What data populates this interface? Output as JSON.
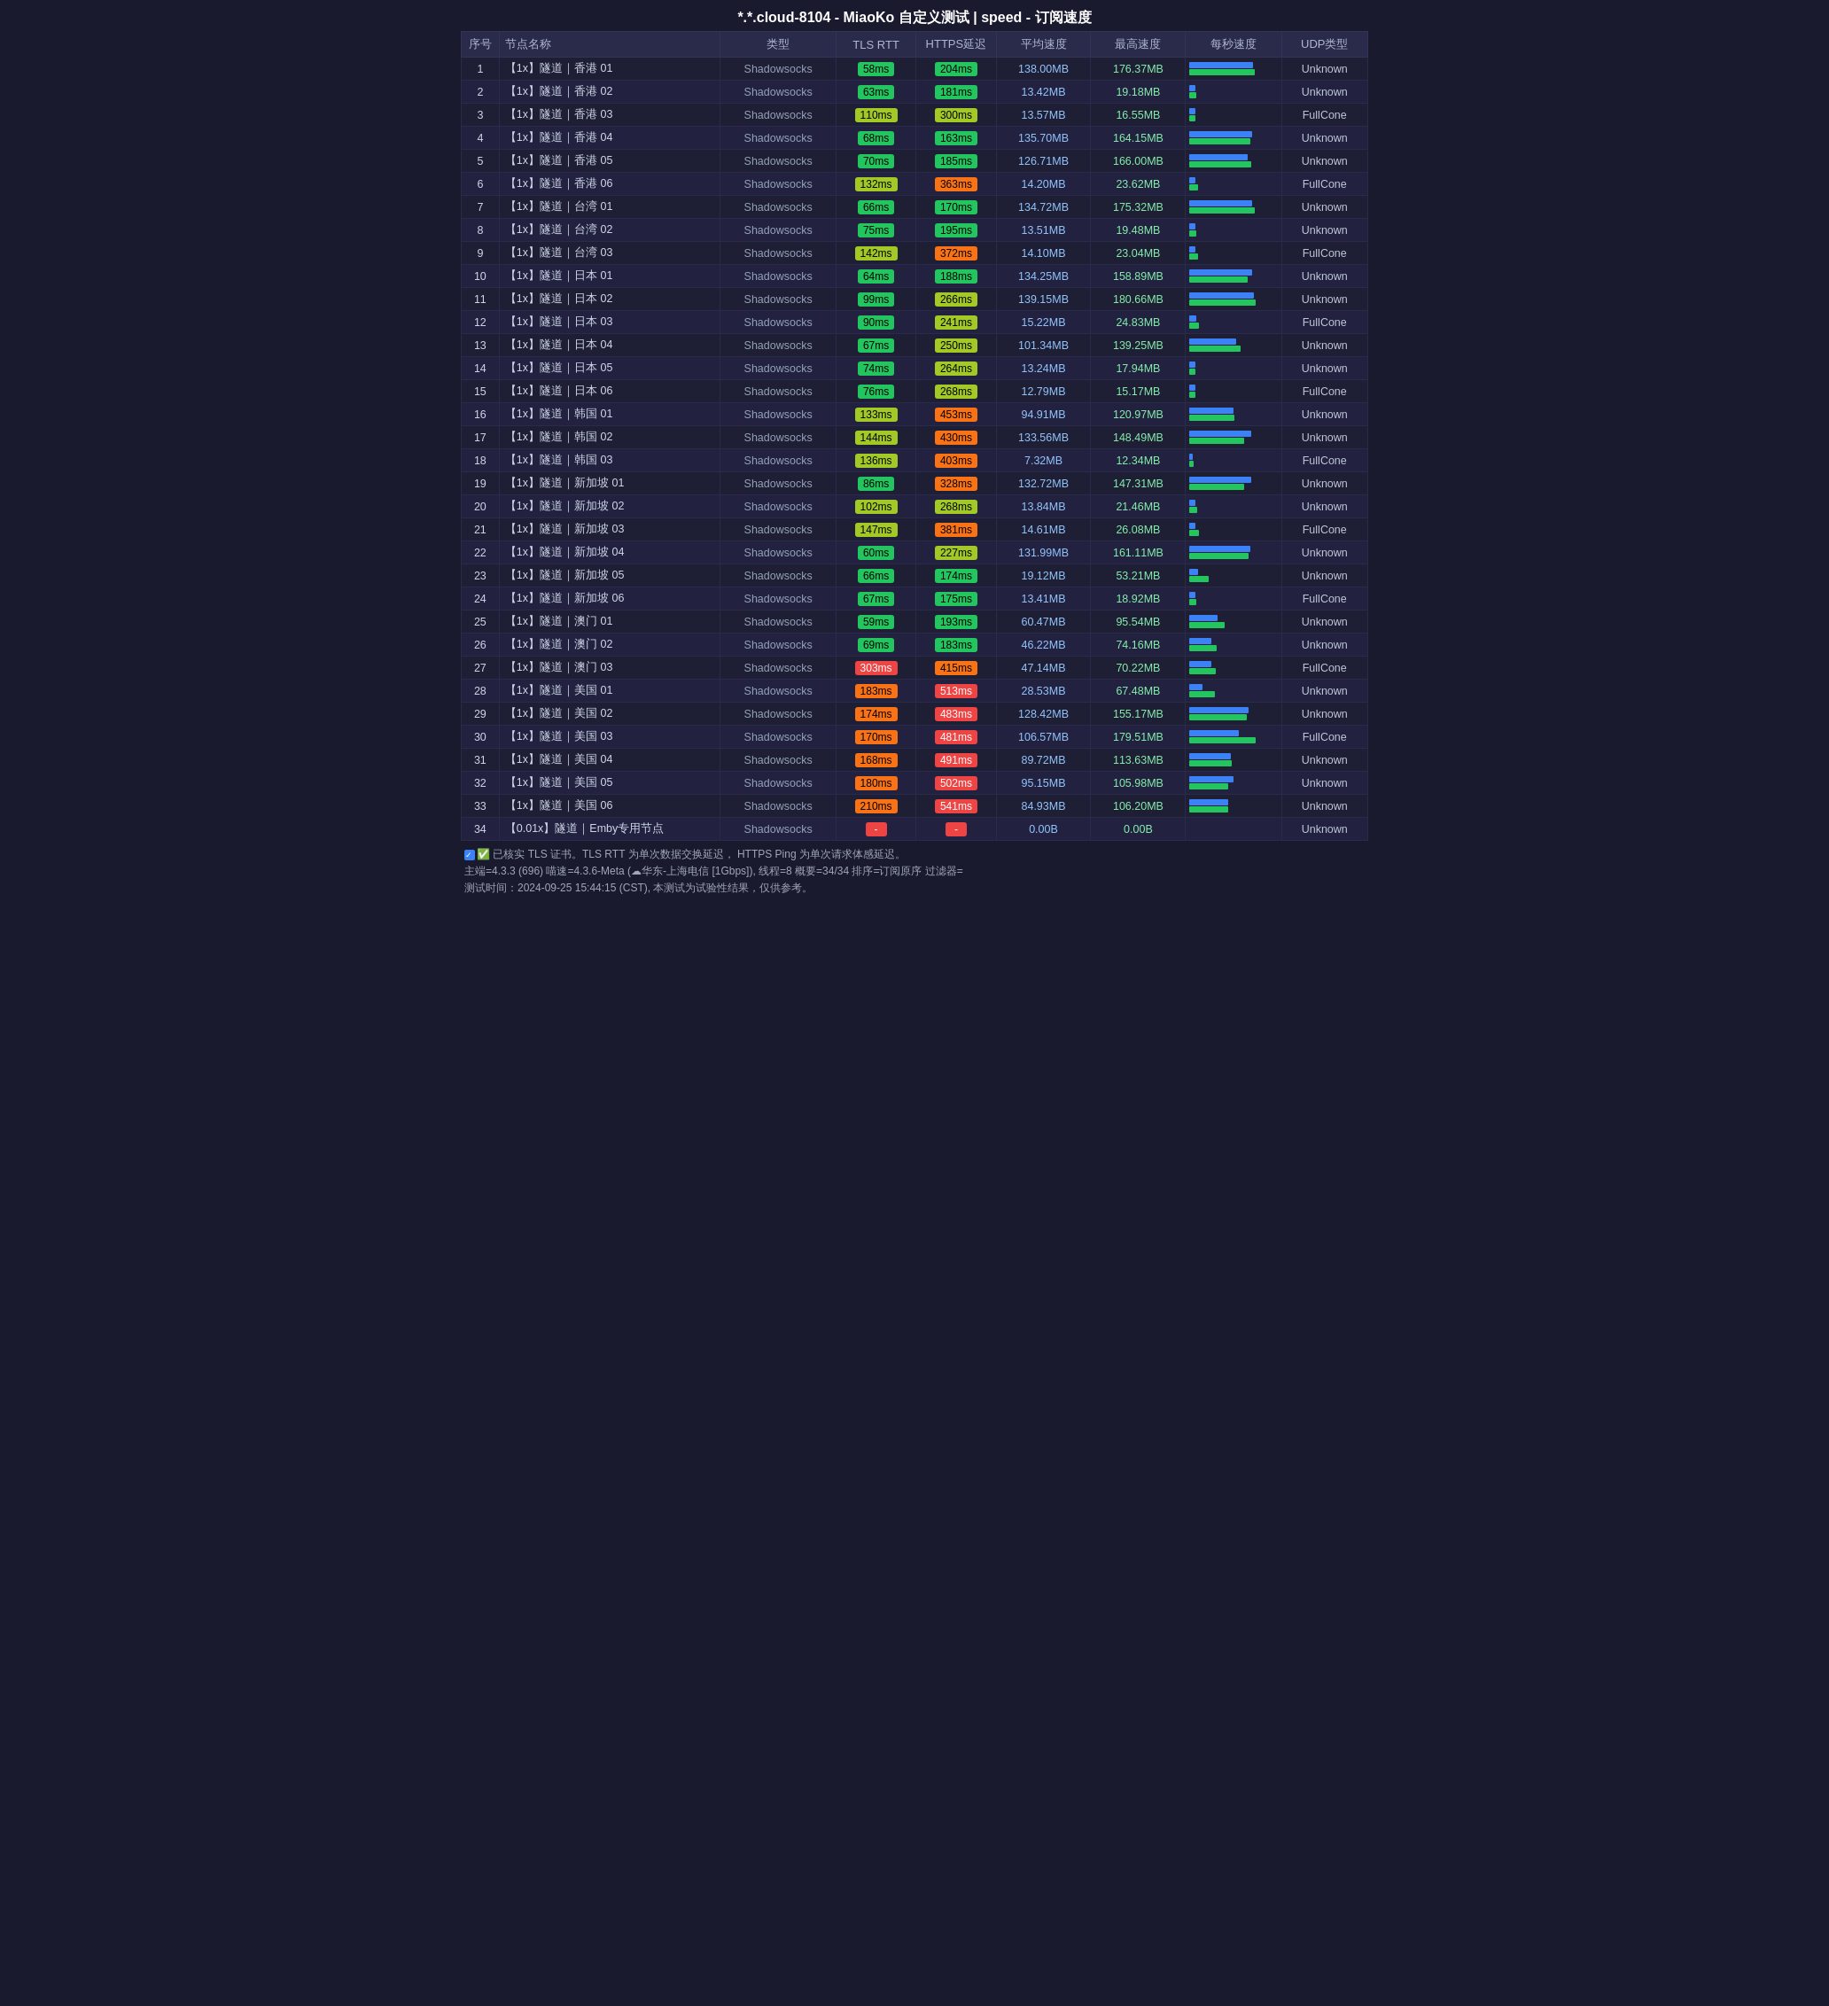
{
  "title": "*.*.cloud-8104 - MiaoKo 自定义测试 | speed - 订阅速度",
  "headers": [
    "序号",
    "节点名称",
    "类型",
    "TLS RTT",
    "HTTPS延迟",
    "平均速度",
    "最高速度",
    "每秒速度",
    "UDP类型"
  ],
  "rows": [
    {
      "id": 1,
      "name": "【1x】隧道｜香港 01",
      "type": "Shadowsocks",
      "tls": "58ms",
      "https": "204ms",
      "avg": "138.00MB",
      "max": "176.37MB",
      "bar_avg": 88,
      "bar_max": 90,
      "udp": "Unknown",
      "tls_color": "green",
      "https_color": "green"
    },
    {
      "id": 2,
      "name": "【1x】隧道｜香港 02",
      "type": "Shadowsocks",
      "tls": "63ms",
      "https": "181ms",
      "avg": "13.42MB",
      "max": "19.18MB",
      "bar_avg": 9,
      "bar_max": 10,
      "udp": "Unknown",
      "tls_color": "green",
      "https_color": "green"
    },
    {
      "id": 3,
      "name": "【1x】隧道｜香港 03",
      "type": "Shadowsocks",
      "tls": "110ms",
      "https": "300ms",
      "avg": "13.57MB",
      "max": "16.55MB",
      "bar_avg": 9,
      "bar_max": 9,
      "udp": "FullCone",
      "tls_color": "yellow",
      "https_color": "yellow"
    },
    {
      "id": 4,
      "name": "【1x】隧道｜香港 04",
      "type": "Shadowsocks",
      "tls": "68ms",
      "https": "163ms",
      "avg": "135.70MB",
      "max": "164.15MB",
      "bar_avg": 86,
      "bar_max": 84,
      "udp": "Unknown",
      "tls_color": "green",
      "https_color": "green"
    },
    {
      "id": 5,
      "name": "【1x】隧道｜香港 05",
      "type": "Shadowsocks",
      "tls": "70ms",
      "https": "185ms",
      "avg": "126.71MB",
      "max": "166.00MB",
      "bar_avg": 80,
      "bar_max": 85,
      "udp": "Unknown",
      "tls_color": "green",
      "https_color": "green"
    },
    {
      "id": 6,
      "name": "【1x】隧道｜香港 06",
      "type": "Shadowsocks",
      "tls": "132ms",
      "https": "363ms",
      "avg": "14.20MB",
      "max": "23.62MB",
      "bar_avg": 9,
      "bar_max": 12,
      "udp": "FullCone",
      "tls_color": "yellow",
      "https_color": "orange"
    },
    {
      "id": 7,
      "name": "【1x】隧道｜台湾 01",
      "type": "Shadowsocks",
      "tls": "66ms",
      "https": "170ms",
      "avg": "134.72MB",
      "max": "175.32MB",
      "bar_avg": 86,
      "bar_max": 90,
      "udp": "Unknown",
      "tls_color": "green",
      "https_color": "green"
    },
    {
      "id": 8,
      "name": "【1x】隧道｜台湾 02",
      "type": "Shadowsocks",
      "tls": "75ms",
      "https": "195ms",
      "avg": "13.51MB",
      "max": "19.48MB",
      "bar_avg": 9,
      "bar_max": 10,
      "udp": "Unknown",
      "tls_color": "green",
      "https_color": "green"
    },
    {
      "id": 9,
      "name": "【1x】隧道｜台湾 03",
      "type": "Shadowsocks",
      "tls": "142ms",
      "https": "372ms",
      "avg": "14.10MB",
      "max": "23.04MB",
      "bar_avg": 9,
      "bar_max": 12,
      "udp": "FullCone",
      "tls_color": "yellow",
      "https_color": "orange"
    },
    {
      "id": 10,
      "name": "【1x】隧道｜日本 01",
      "type": "Shadowsocks",
      "tls": "64ms",
      "https": "188ms",
      "avg": "134.25MB",
      "max": "158.89MB",
      "bar_avg": 86,
      "bar_max": 81,
      "udp": "Unknown",
      "tls_color": "green",
      "https_color": "green"
    },
    {
      "id": 11,
      "name": "【1x】隧道｜日本 02",
      "type": "Shadowsocks",
      "tls": "99ms",
      "https": "266ms",
      "avg": "139.15MB",
      "max": "180.66MB",
      "bar_avg": 89,
      "bar_max": 92,
      "udp": "Unknown",
      "tls_color": "green",
      "https_color": "yellow"
    },
    {
      "id": 12,
      "name": "【1x】隧道｜日本 03",
      "type": "Shadowsocks",
      "tls": "90ms",
      "https": "241ms",
      "avg": "15.22MB",
      "max": "24.83MB",
      "bar_avg": 10,
      "bar_max": 13,
      "udp": "FullCone",
      "tls_color": "green",
      "https_color": "yellow"
    },
    {
      "id": 13,
      "name": "【1x】隧道｜日本 04",
      "type": "Shadowsocks",
      "tls": "67ms",
      "https": "250ms",
      "avg": "101.34MB",
      "max": "139.25MB",
      "bar_avg": 65,
      "bar_max": 71,
      "udp": "Unknown",
      "tls_color": "green",
      "https_color": "yellow"
    },
    {
      "id": 14,
      "name": "【1x】隧道｜日本 05",
      "type": "Shadowsocks",
      "tls": "74ms",
      "https": "264ms",
      "avg": "13.24MB",
      "max": "17.94MB",
      "bar_avg": 8,
      "bar_max": 9,
      "udp": "Unknown",
      "tls_color": "green",
      "https_color": "yellow"
    },
    {
      "id": 15,
      "name": "【1x】隧道｜日本 06",
      "type": "Shadowsocks",
      "tls": "76ms",
      "https": "268ms",
      "avg": "12.79MB",
      "max": "15.17MB",
      "bar_avg": 8,
      "bar_max": 8,
      "udp": "FullCone",
      "tls_color": "green",
      "https_color": "yellow"
    },
    {
      "id": 16,
      "name": "【1x】隧道｜韩国 01",
      "type": "Shadowsocks",
      "tls": "133ms",
      "https": "453ms",
      "avg": "94.91MB",
      "max": "120.97MB",
      "bar_avg": 61,
      "bar_max": 62,
      "udp": "Unknown",
      "tls_color": "yellow",
      "https_color": "orange"
    },
    {
      "id": 17,
      "name": "【1x】隧道｜韩国 02",
      "type": "Shadowsocks",
      "tls": "144ms",
      "https": "430ms",
      "avg": "133.56MB",
      "max": "148.49MB",
      "bar_avg": 85,
      "bar_max": 76,
      "udp": "Unknown",
      "tls_color": "yellow",
      "https_color": "orange"
    },
    {
      "id": 18,
      "name": "【1x】隧道｜韩国 03",
      "type": "Shadowsocks",
      "tls": "136ms",
      "https": "403ms",
      "avg": "7.32MB",
      "max": "12.34MB",
      "bar_avg": 5,
      "bar_max": 6,
      "udp": "FullCone",
      "tls_color": "yellow",
      "https_color": "orange"
    },
    {
      "id": 19,
      "name": "【1x】隧道｜新加坡 01",
      "type": "Shadowsocks",
      "tls": "86ms",
      "https": "328ms",
      "avg": "132.72MB",
      "max": "147.31MB",
      "bar_avg": 85,
      "bar_max": 75,
      "udp": "Unknown",
      "tls_color": "green",
      "https_color": "orange"
    },
    {
      "id": 20,
      "name": "【1x】隧道｜新加坡 02",
      "type": "Shadowsocks",
      "tls": "102ms",
      "https": "268ms",
      "avg": "13.84MB",
      "max": "21.46MB",
      "bar_avg": 9,
      "bar_max": 11,
      "udp": "Unknown",
      "tls_color": "yellow",
      "https_color": "yellow"
    },
    {
      "id": 21,
      "name": "【1x】隧道｜新加坡 03",
      "type": "Shadowsocks",
      "tls": "147ms",
      "https": "381ms",
      "avg": "14.61MB",
      "max": "26.08MB",
      "bar_avg": 9,
      "bar_max": 13,
      "udp": "FullCone",
      "tls_color": "yellow",
      "https_color": "orange"
    },
    {
      "id": 22,
      "name": "【1x】隧道｜新加坡 04",
      "type": "Shadowsocks",
      "tls": "60ms",
      "https": "227ms",
      "avg": "131.99MB",
      "max": "161.11MB",
      "bar_avg": 84,
      "bar_max": 82,
      "udp": "Unknown",
      "tls_color": "green",
      "https_color": "yellow"
    },
    {
      "id": 23,
      "name": "【1x】隧道｜新加坡 05",
      "type": "Shadowsocks",
      "tls": "66ms",
      "https": "174ms",
      "avg": "19.12MB",
      "max": "53.21MB",
      "bar_avg": 12,
      "bar_max": 27,
      "udp": "Unknown",
      "tls_color": "green",
      "https_color": "green"
    },
    {
      "id": 24,
      "name": "【1x】隧道｜新加坡 06",
      "type": "Shadowsocks",
      "tls": "67ms",
      "https": "175ms",
      "avg": "13.41MB",
      "max": "18.92MB",
      "bar_avg": 9,
      "bar_max": 10,
      "udp": "FullCone",
      "tls_color": "green",
      "https_color": "green"
    },
    {
      "id": 25,
      "name": "【1x】隧道｜澳门 01",
      "type": "Shadowsocks",
      "tls": "59ms",
      "https": "193ms",
      "avg": "60.47MB",
      "max": "95.54MB",
      "bar_avg": 39,
      "bar_max": 49,
      "udp": "Unknown",
      "tls_color": "green",
      "https_color": "green"
    },
    {
      "id": 26,
      "name": "【1x】隧道｜澳门 02",
      "type": "Shadowsocks",
      "tls": "69ms",
      "https": "183ms",
      "avg": "46.22MB",
      "max": "74.16MB",
      "bar_avg": 30,
      "bar_max": 38,
      "udp": "Unknown",
      "tls_color": "green",
      "https_color": "green"
    },
    {
      "id": 27,
      "name": "【1x】隧道｜澳门 03",
      "type": "Shadowsocks",
      "tls": "303ms",
      "https": "415ms",
      "avg": "47.14MB",
      "max": "70.22MB",
      "bar_avg": 30,
      "bar_max": 36,
      "udp": "FullCone",
      "tls_color": "red",
      "https_color": "orange"
    },
    {
      "id": 28,
      "name": "【1x】隧道｜美国 01",
      "type": "Shadowsocks",
      "tls": "183ms",
      "https": "513ms",
      "avg": "28.53MB",
      "max": "67.48MB",
      "bar_avg": 18,
      "bar_max": 35,
      "udp": "Unknown",
      "tls_color": "orange",
      "https_color": "red"
    },
    {
      "id": 29,
      "name": "【1x】隧道｜美国 02",
      "type": "Shadowsocks",
      "tls": "174ms",
      "https": "483ms",
      "avg": "128.42MB",
      "max": "155.17MB",
      "bar_avg": 82,
      "bar_max": 79,
      "udp": "Unknown",
      "tls_color": "orange",
      "https_color": "red"
    },
    {
      "id": 30,
      "name": "【1x】隧道｜美国 03",
      "type": "Shadowsocks",
      "tls": "170ms",
      "https": "481ms",
      "avg": "106.57MB",
      "max": "179.51MB",
      "bar_avg": 68,
      "bar_max": 92,
      "udp": "FullCone",
      "tls_color": "orange",
      "https_color": "red"
    },
    {
      "id": 31,
      "name": "【1x】隧道｜美国 04",
      "type": "Shadowsocks",
      "tls": "168ms",
      "https": "491ms",
      "avg": "89.72MB",
      "max": "113.63MB",
      "bar_avg": 57,
      "bar_max": 58,
      "udp": "Unknown",
      "tls_color": "orange",
      "https_color": "red"
    },
    {
      "id": 32,
      "name": "【1x】隧道｜美国 05",
      "type": "Shadowsocks",
      "tls": "180ms",
      "https": "502ms",
      "avg": "95.15MB",
      "max": "105.98MB",
      "bar_avg": 61,
      "bar_max": 54,
      "udp": "Unknown",
      "tls_color": "orange",
      "https_color": "red"
    },
    {
      "id": 33,
      "name": "【1x】隧道｜美国 06",
      "type": "Shadowsocks",
      "tls": "210ms",
      "https": "541ms",
      "avg": "84.93MB",
      "max": "106.20MB",
      "bar_avg": 54,
      "bar_max": 54,
      "udp": "Unknown",
      "tls_color": "orange",
      "https_color": "red"
    },
    {
      "id": 34,
      "name": "【0.01x】隧道｜Emby专用节点",
      "type": "Shadowsocks",
      "tls": "-",
      "https": "-",
      "avg": "0.00B",
      "max": "0.00B",
      "bar_avg": 0,
      "bar_max": 0,
      "udp": "Unknown",
      "tls_color": "red",
      "https_color": "red",
      "special": true
    }
  ],
  "footer1": "✅ 已核实 TLS 证书。TLS RTT 为单次数据交换延迟， HTTPS Ping 为单次请求体感延迟。",
  "footer2": "主端=4.3.3 (696) 喵速=4.3.6-Meta (☁华东-上海电信 [1Gbps]), 线程=8 概要=34/34 排序=订阅原序 过滤器=",
  "footer3": "测试时间：2024-09-25 15:44:15 (CST), 本测试为试验性结果，仅供参考。"
}
